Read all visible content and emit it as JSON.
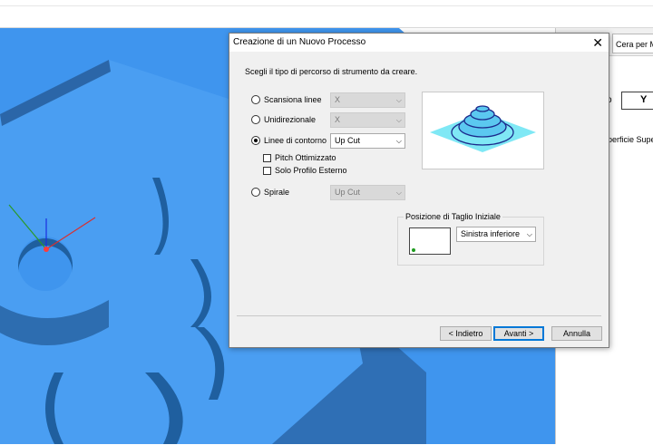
{
  "right_panel": {
    "tab_label": "Cera per Mo",
    "button_label": "Y",
    "partial_label": "o",
    "surface_label": "uperficie Supe"
  },
  "dialog": {
    "title": "Creazione di un Nuovo Processo",
    "close_glyph": "✕",
    "instruction": "Scegli il tipo di percorso di strumento da creare.",
    "options": [
      {
        "label": "Scansiona linee",
        "selected": false,
        "combo_value": "X",
        "combo_enabled": false
      },
      {
        "label": "Unidirezionale",
        "selected": false,
        "combo_value": "X",
        "combo_enabled": false
      },
      {
        "label": "Linee di contorno",
        "selected": true,
        "combo_value": "Up Cut",
        "combo_enabled": true
      },
      {
        "label": "Spirale",
        "selected": false,
        "combo_value": "Up Cut",
        "combo_enabled": false
      }
    ],
    "checkboxes": [
      {
        "label": "Pitch Ottimizzato",
        "checked": false
      },
      {
        "label": "Solo Profilo Esterno",
        "checked": false
      }
    ],
    "group_title": "Posizione di Taglio Iniziale",
    "start_position_value": "Sinistra inferiore",
    "buttons": {
      "back": "< Indietro",
      "next": "Avanti >",
      "cancel": "Annulla"
    }
  },
  "colors": {
    "model_blue": "#3f95ee",
    "model_dark": "#2f6fb5",
    "preview_plane": "#7fe8f5",
    "preview_stroke": "#1c2a8c",
    "accent": "#0078d7"
  }
}
